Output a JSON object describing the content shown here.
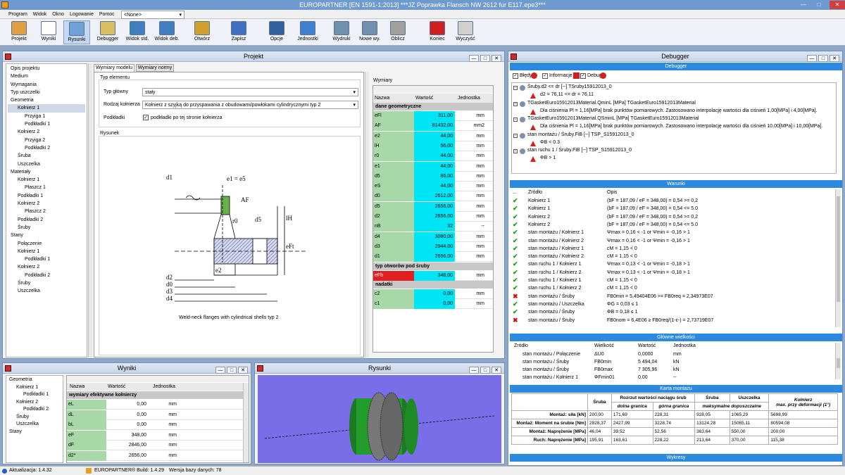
{
  "app": {
    "title": "EUROPARTNER [EN 1591-1:2013] ***JZ Poprawka Flansch NW 2612 fur E117.epe3***"
  },
  "menu": [
    "Program",
    "Widok",
    "Okno",
    "Logowanie",
    "Pomoc"
  ],
  "menu_combo": "<None>",
  "toolbar": [
    {
      "label": "Projekt",
      "icon": "project-icon"
    },
    {
      "label": "Wyniki",
      "icon": "results-icon"
    },
    {
      "label": "Rysunki",
      "icon": "drawings-icon"
    },
    {
      "label": "Debugger",
      "icon": "debugger-icon"
    },
    {
      "label": "Widok std.",
      "icon": "std-view-icon"
    },
    {
      "label": "Widok deb.",
      "icon": "deb-view-icon"
    },
    {
      "label": "Otwórz",
      "icon": "open-icon"
    },
    {
      "label": "Zapisz",
      "icon": "save-icon"
    },
    {
      "label": "Opcje",
      "icon": "options-icon"
    },
    {
      "label": "Jednostki",
      "icon": "units-icon"
    },
    {
      "label": "Wydruki",
      "icon": "print-icon"
    },
    {
      "label": "Nowe wy.",
      "icon": "new-print-icon"
    },
    {
      "label": "Oblicz",
      "icon": "calculate-icon"
    },
    {
      "label": "Koniec",
      "icon": "exit-icon"
    },
    {
      "label": "Wyczyść",
      "icon": "clear-icon"
    }
  ],
  "projekt": {
    "title": "Projekt",
    "tree": [
      {
        "t": "Opis projektu",
        "l": 0
      },
      {
        "t": "Medium",
        "l": 0
      },
      {
        "t": "Wymagania",
        "l": 0
      },
      {
        "t": "Typ uszczelki",
        "l": 0
      },
      {
        "t": "Geometria",
        "l": 0
      },
      {
        "t": "Kołnierz 1",
        "l": 1
      },
      {
        "t": "Przyiga 1",
        "l": 2
      },
      {
        "t": "Podkładki 1",
        "l": 2
      },
      {
        "t": "Kołnierz 2",
        "l": 1
      },
      {
        "t": "Przyiga 2",
        "l": 2
      },
      {
        "t": "Podkładki 2",
        "l": 2
      },
      {
        "t": "Śruba",
        "l": 1
      },
      {
        "t": "Uszczelka",
        "l": 1
      },
      {
        "t": "Materiały",
        "l": 0
      },
      {
        "t": "Kołnierz 1",
        "l": 1
      },
      {
        "t": "Płaszcz 1",
        "l": 2
      },
      {
        "t": "Podkładki 1",
        "l": 1
      },
      {
        "t": "Kołnierz 2",
        "l": 1
      },
      {
        "t": "Płaszcz 2",
        "l": 2
      },
      {
        "t": "Podkładki 2",
        "l": 1
      },
      {
        "t": "Śruby",
        "l": 1
      },
      {
        "t": "Stany",
        "l": 0
      },
      {
        "t": "Połączenie",
        "l": 1
      },
      {
        "t": "Kołnierz 1",
        "l": 1
      },
      {
        "t": "Podkładki 1",
        "l": 2
      },
      {
        "t": "Kołnierz 2",
        "l": 1
      },
      {
        "t": "Podkładki 2",
        "l": 2
      },
      {
        "t": "Śruby",
        "l": 1
      },
      {
        "t": "Uszczelka",
        "l": 1
      }
    ],
    "tabs": [
      "Wymiary modelu",
      "Wymiary normy"
    ],
    "typ_elementu": "Typ elementu",
    "typ_glowny_label": "Typ główny",
    "typ_glowny": "stały",
    "rodzaj_label": "Rodzaj kołnierza",
    "rodzaj": "Kołnierz z szyjką do przyspawania z obudowami/powłokami cylindrycznymi typ 2",
    "podkladki_label": "Podkładki",
    "podkladki_check": "podkładki po tej stronie kołnierza",
    "rysunek": "Rysunek",
    "caption": "Weld-neck flanges with cylindrical shells typ 2",
    "drawing_labels": {
      "d1": "d1",
      "e1e5": "e1 = e5",
      "af": "AF",
      "d5": "d5",
      "r0": "r0",
      "lh": "lH",
      "eft": "eFt",
      "e2": "e2",
      "d2": "d2",
      "d0": "d0",
      "d3": "d3",
      "d4": "d4"
    },
    "wymiary_title": "Wymiary",
    "cols": [
      "Nazwa",
      "Wartość",
      "Jednostka"
    ],
    "sections": [
      {
        "name": "dane geometryczne",
        "rows": [
          [
            "eFl",
            "311,00",
            "mm"
          ],
          [
            "AF",
            "81432,00",
            "mm2"
          ],
          [
            "e2",
            "44,00",
            "mm"
          ],
          [
            "lH",
            "56,00",
            "mm"
          ],
          [
            "r0",
            "44,00",
            "mm"
          ],
          [
            "e1",
            "44,00",
            "mm"
          ],
          [
            "d5",
            "86,00",
            "mm"
          ],
          [
            "eS",
            "44,00",
            "mm"
          ],
          [
            "d0",
            "2612,00",
            "mm"
          ],
          [
            "d5",
            "2656,00",
            "mm"
          ],
          [
            "d2",
            "2656,00",
            "mm"
          ],
          [
            "nB",
            "32",
            "--"
          ],
          [
            "d4",
            "3080,00",
            "mm"
          ],
          [
            "d3",
            "2944,00",
            "mm"
          ],
          [
            "d1",
            "2656,00",
            "mm"
          ]
        ]
      },
      {
        "name": "typ otworów pod śruby",
        "rows": [
          [
            "eFb",
            "348,00",
            "mm"
          ]
        ]
      },
      {
        "name": "nadatki",
        "rows": [
          [
            "c2",
            "0,00",
            "mm"
          ],
          [
            "c1",
            "0,00",
            "mm"
          ]
        ]
      }
    ]
  },
  "debugger": {
    "title": "Debugger",
    "bar": "Debugger",
    "filters": [
      "Błędy",
      "Informacje",
      "Debug"
    ],
    "entries": [
      {
        "head": "Śruby.d2 <= dr [--] TSruby15912013_0",
        "msg": "d2 = 76,11 <= dr = 76,11"
      },
      {
        "head": "TGasketEuro15912013Material.QminL [MPa] TGasketEuro15912013Material",
        "msg": "Dla ciśnienia Pl = 1,16[MPa] brak punktów pomiarowych. Zastosowano interpolację wartości dla ciśnień 1,00[MPa] i 4,00[MPa]."
      },
      {
        "head": "TGasketEuro15912013Material.QSminL [MPa] TGasketEuro15912013Material",
        "msg": "Dla ciśnienia Pl = 1,16[MPa] brak punktów pomiarowych. Zastosowano interpolację wartości dla ciśnień 10,00[MPa] i 10,00[MPa]."
      },
      {
        "head": "stan montażu / Śruby.FiB [--] TSP_S15912013_0",
        "msg": "ΦB < 0.3"
      },
      {
        "head": "stan ruchu 1 / Śruby.FiB [--] TSP_S15912013_0",
        "msg": "ΦB > 1"
      }
    ]
  },
  "warunki": {
    "title": "Warunki",
    "cols": [
      "Źródło",
      "Opis"
    ],
    "rows": [
      {
        "s": "ok",
        "src": "Kołnierz 1",
        "d": "(bF = 187,09 / eF = 348,00) = 0,54 >= 0,2"
      },
      {
        "s": "ok",
        "src": "Kołnierz 1",
        "d": "(bF = 187,09 / eF = 348,00) = 0,54 <= 5.0"
      },
      {
        "s": "ok",
        "src": "Kołnierz 2",
        "d": "(bF = 187,09 / eF = 348,00) = 0,54 >= 0,2"
      },
      {
        "s": "ok",
        "src": "Kołnierz 2",
        "d": "(bF = 187,09 / eF = 348,00) = 0,54 <= 5.0"
      },
      {
        "s": "ok",
        "src": "stan montażu / Kołnierz 1",
        "d": "Ψmax = 0,16 < -1 or Ψmin = -0,16 > 1"
      },
      {
        "s": "ok",
        "src": "stan montażu / Kołnierz 2",
        "d": "Ψmax = 0,16 < -1 or Ψmin = -0,16 > 1"
      },
      {
        "s": "ok",
        "src": "stan montażu / Kołnierz 1",
        "d": "cM = 1,15 < 0"
      },
      {
        "s": "ok",
        "src": "stan montażu / Kołnierz 2",
        "d": "cM = 1,15 < 0"
      },
      {
        "s": "ok",
        "src": "stan ruchu 1 / Kołnierz 1",
        "d": "Ψmax = 0,13 < -1 or Ψmin = -0,18 > 1"
      },
      {
        "s": "ok",
        "src": "stan ruchu 1 / Kołnierz 2",
        "d": "Ψmax = 0,13 < -1 or Ψmin = -0,18 > 1"
      },
      {
        "s": "ok",
        "src": "stan ruchu 1 / Kołnierz 1",
        "d": "cM = 1,15 < 0"
      },
      {
        "s": "ok",
        "src": "stan ruchu 1 / Kołnierz 2",
        "d": "cM = 1,15 < 0"
      },
      {
        "s": "err",
        "src": "stan montażu / Śruby",
        "d": "FB0min = 5,49404E06 >= FB0req = 2,34973E07"
      },
      {
        "s": "ok",
        "src": "stan montażu / Uszczelka",
        "d": "ΦG = 0,03 ≤ 1"
      },
      {
        "s": "ok",
        "src": "stan montażu / Śruby",
        "d": "ΦB = 0,18 ≤ 1"
      },
      {
        "s": "err",
        "src": "stan montażu / Śruby",
        "d": "FB0nom = 6,4E06 ≥ FB0req/(1-ε-) = 2,73719E07"
      }
    ]
  },
  "glowne": {
    "title": "Główne wielkości",
    "cols": [
      "Źródło",
      "Wielkość",
      "Wartość",
      "Jednostka"
    ],
    "rows": [
      [
        "stan montażu / Połączenie",
        "ΔU0",
        "0,0000",
        "mm"
      ],
      [
        "stan montażu / Śruby",
        "FB0min",
        "5 494,04",
        "kN"
      ],
      [
        "stan montażu / Śruby",
        "FB0max",
        "7 305,96",
        "kN"
      ],
      [
        "stan montażu / Kołnierz 1",
        "ΦFmin01",
        "0,00",
        "--"
      ]
    ]
  },
  "karta": {
    "title": "Karta montażu",
    "h_sruba": "Śruba",
    "h_rozrzut": "Rozrzut wartości naciągu śrub",
    "h_dolna": "dolna granica",
    "h_gorna": "górna granica",
    "h_sruba2": "Śruba",
    "h_max": "maksymalne dopuszczalne",
    "h_uszczelka": "Uszczelka",
    "h_kolnierz": "Kołnierz",
    "h_kol_sub": "max. przy deformacji (1°)",
    "rows": [
      [
        "Montaż: siła [kN]",
        "200,00",
        "171,69",
        "228,31",
        "928,05",
        "1065,29",
        "5698,99"
      ],
      [
        "Montaż: Moment na śrubie [Nm]",
        "2828,37",
        "2427,99",
        "3228,74",
        "13124,28",
        "15065,11",
        "80594,08"
      ],
      [
        "Montaż: Naprężenie [MPa]",
        "46,04",
        "39,52",
        "52,56",
        "363,64",
        "550,00",
        "200,00"
      ],
      [
        "Ruch: Naprężenie [MPa]",
        "195,91",
        "163,61",
        "228,22",
        "213,64",
        "370,00",
        "115,38"
      ]
    ],
    "wykresy": "Wykresy"
  },
  "wyniki": {
    "title": "Wyniki",
    "tree": [
      {
        "t": "Geometria",
        "l": 0
      },
      {
        "t": "Kołnierz 1",
        "l": 1
      },
      {
        "t": "Podkładki 1",
        "l": 2
      },
      {
        "t": "Kołnierz 2",
        "l": 1
      },
      {
        "t": "Podkładki 2",
        "l": 2
      },
      {
        "t": "Śruby",
        "l": 1
      },
      {
        "t": "Uszczelka",
        "l": 1
      },
      {
        "t": "Stany",
        "l": 0
      }
    ],
    "cols": [
      "Nazwa",
      "Wartość",
      "Jednostka"
    ],
    "section": "wymiary efektywne kołnierzy",
    "rows": [
      [
        "eL",
        "0,00",
        "mm"
      ],
      [
        "dL",
        "0,00",
        "mm"
      ],
      [
        "bL",
        "0,00",
        "mm"
      ],
      [
        "eF",
        "348,00",
        "mm"
      ],
      [
        "dF",
        "2846,00",
        "mm"
      ],
      [
        "d2*",
        "2656,00",
        "mm"
      ]
    ]
  },
  "rysunki": {
    "title": "Rysunki"
  },
  "status": {
    "left": "Aktualizacja: 1.4.32",
    "build": "EUROPARTNER® Build: 1.4.29",
    "db": "Wersja bazy danych: 78"
  }
}
